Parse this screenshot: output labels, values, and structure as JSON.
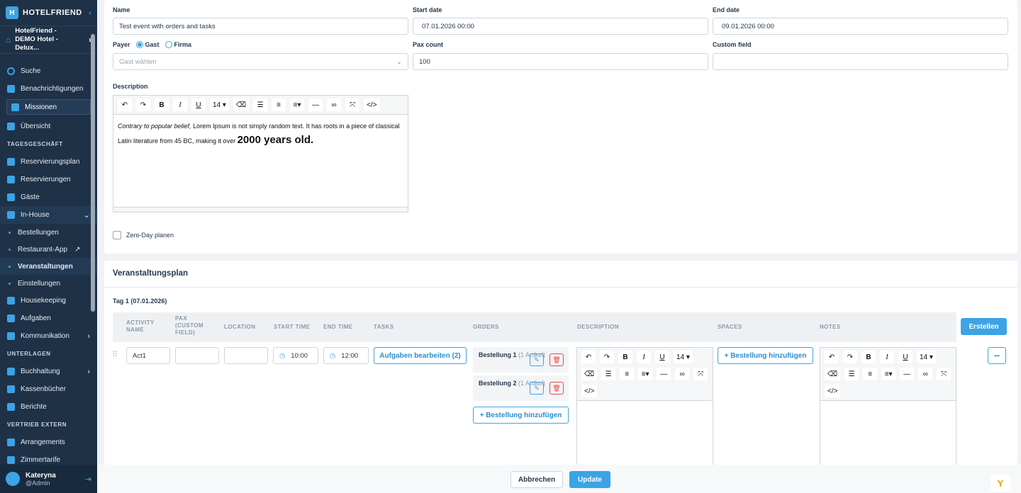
{
  "sidebar": {
    "brand": "HOTELFRIEND",
    "hotel": "HotelFriend - DEMO Hotel - Delux...",
    "items": [
      {
        "label": "Suche"
      },
      {
        "label": "Benachrichtigungen"
      },
      {
        "label": "Missionen"
      },
      {
        "label": "Übersicht"
      }
    ],
    "section1": "TAGESGESCHÄFT",
    "tages": [
      {
        "label": "Reservierungsplan"
      },
      {
        "label": "Reservierungen"
      },
      {
        "label": "Gäste"
      },
      {
        "label": "In-House"
      }
    ],
    "inhouse_sub": [
      {
        "label": "Bestellungen"
      },
      {
        "label": "Restaurant-App"
      },
      {
        "label": "Veranstaltungen"
      },
      {
        "label": "Einstellungen"
      }
    ],
    "more": [
      {
        "label": "Housekeeping"
      },
      {
        "label": "Aufgaben"
      },
      {
        "label": "Kommunikation"
      }
    ],
    "section2": "UNTERLAGEN",
    "unterlagen": [
      {
        "label": "Buchhaltung"
      },
      {
        "label": "Kassenbücher"
      },
      {
        "label": "Berichte"
      }
    ],
    "section3": "VERTRIEB EXTERN",
    "vertrieb": [
      {
        "label": "Arrangements"
      },
      {
        "label": "Zimmertarife"
      }
    ],
    "user": {
      "name": "Kateryna",
      "role": "@Admin"
    }
  },
  "form": {
    "name_label": "Name",
    "name_value": "Test event with orders and tasks",
    "start_label": "Start date",
    "start_value": "07.01.2026 00:00",
    "end_label": "End date",
    "end_value": "09.01.2026 00:00",
    "payer_label": "Payer",
    "payer_opt1": "Gast",
    "payer_opt2": "Firma",
    "guest_placeholder": "Gast wählen",
    "pax_label": "Pax count",
    "pax_value": "100",
    "custom_label": "Custom field",
    "custom_value": "",
    "desc_label": "Description",
    "font_size": "14",
    "desc_italic": "Contrary to popular belief,",
    "desc_text1": " Lorem Ipsum is not simply random text. It has roots in a piece of classical Latin literature from 45 BC, making it over ",
    "desc_big": "2000 years old.",
    "zero_day": "Zero-Day planen"
  },
  "plan": {
    "title": "Veranstaltungsplan",
    "day": "Tag 1 (07.01.2026)",
    "headers": {
      "activity": "ACTIVITY NAME",
      "pax": "PAX (CUSTOM FIELD)",
      "location": "LOCATION",
      "start": "START TIME",
      "end": "END TIME",
      "tasks": "TASKS",
      "orders": "ORDERS",
      "description": "DESCRIPTION",
      "spaces": "SPACES",
      "notes": "NOTES"
    },
    "create_button": "Erstellen",
    "row": {
      "activity": "Act1",
      "start": "10:00",
      "end": "12:00",
      "tasks_button": "Aufgaben bearbeiten (2)",
      "orders": [
        {
          "name": "Bestellung 1",
          "count": "(1 Artikel)"
        },
        {
          "name": "Bestellung 2",
          "count": "(1 Artikel)"
        }
      ],
      "add_order": "Bestellung hinzufügen",
      "add_space": "Bestellung hinzufügen",
      "font_size": "14"
    }
  },
  "footer": {
    "cancel": "Abbrechen",
    "update": "Update"
  },
  "colors": {
    "accent": "#3ba3e6",
    "sidebar": "#1e3147",
    "danger": "#e64a4a"
  }
}
